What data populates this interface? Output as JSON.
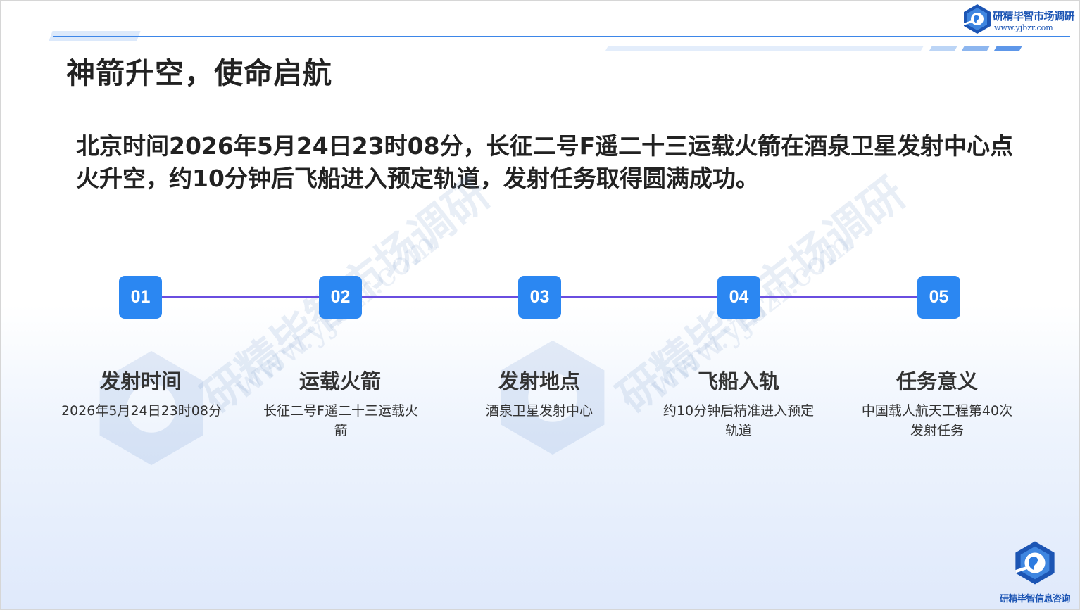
{
  "header": {
    "brand_name": "研精毕智市场调研",
    "brand_url": "www.yjbzr.com"
  },
  "title": "神箭升空，使命启航",
  "intro": "北京时间2026年5月24日23时08分，长征二号F遥二十三运载火箭在酒泉卫星发射中心点火升空，约10分钟后飞船进入预定轨道，发射任务取得圆满成功。",
  "watermark": {
    "text": "研精毕智市场调研",
    "url": "www.yjbzr.com"
  },
  "steps": [
    {
      "number": "01",
      "title": "发射时间",
      "desc": "2026年5月24日23时08分"
    },
    {
      "number": "02",
      "title": "运载火箭",
      "desc": "长征二号F遥二十三运载火箭"
    },
    {
      "number": "03",
      "title": "发射地点",
      "desc": "酒泉卫星发射中心"
    },
    {
      "number": "04",
      "title": "飞船入轨",
      "desc": "约10分钟后精准进入预定轨道"
    },
    {
      "number": "05",
      "title": "任务意义",
      "desc": "中国载人航天工程第40次发射任务"
    }
  ],
  "footer": {
    "brand_name": "研精毕智信息咨询"
  },
  "colors": {
    "accent": "#2b87f2",
    "timeline": "#6a4ee0",
    "brand": "#1c55b4"
  }
}
